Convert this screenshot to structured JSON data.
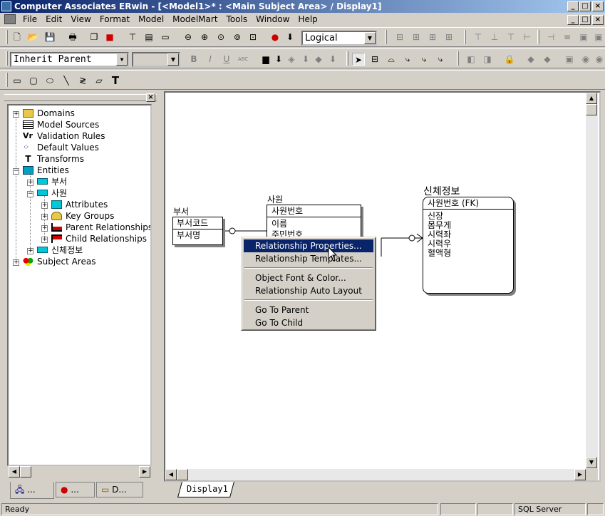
{
  "window": {
    "title": "Computer Associates ERwin - [<Model1>* : <Main Subject Area> / Display1]",
    "controls": [
      "_",
      "□",
      "×"
    ]
  },
  "menu": [
    "File",
    "Edit",
    "View",
    "Format",
    "Model",
    "ModelMart",
    "Tools",
    "Window",
    "Help"
  ],
  "toolbar": {
    "view_mode": "Logical",
    "font_combo": "Inherit Parent",
    "size_combo": "",
    "text_buttons": [
      "B",
      "I",
      "U",
      "ABC"
    ],
    "text_tool": "T"
  },
  "tree": {
    "items": [
      {
        "label": "Domains",
        "expand": "+"
      },
      {
        "label": "Model Sources",
        "expand": ""
      },
      {
        "label": "Validation Rules",
        "expand": ""
      },
      {
        "label": "Default Values",
        "expand": ""
      },
      {
        "label": "Transforms",
        "expand": ""
      },
      {
        "label": "Entities",
        "expand": "−"
      },
      {
        "label": "부서",
        "expand": "+"
      },
      {
        "label": "사원",
        "expand": "−"
      },
      {
        "label": "Attributes",
        "expand": "+"
      },
      {
        "label": "Key Groups",
        "expand": "+"
      },
      {
        "label": "Parent Relationships",
        "expand": "+"
      },
      {
        "label": "Child Relationships",
        "expand": "+"
      },
      {
        "label": "신체정보",
        "expand": "+"
      },
      {
        "label": "Subject Areas",
        "expand": "+"
      }
    ],
    "tabs": [
      "...",
      "...",
      "D..."
    ]
  },
  "diagram": {
    "entities": [
      {
        "name": "부서",
        "key": [
          "부서코드"
        ],
        "attrs": [
          "부서명"
        ]
      },
      {
        "name": "사원",
        "key": [
          "사원번호"
        ],
        "attrs": [
          "이름",
          "주민번호"
        ]
      },
      {
        "name": "신체정보",
        "key": [
          "사원번호 (FK)"
        ],
        "attrs": [
          "신장",
          "몸무게",
          "시력좌",
          "시력우",
          "혈액형"
        ]
      }
    ],
    "tab": "Display1"
  },
  "context_menu": {
    "items": [
      "Relationship Properties...",
      "Relationship Templates...",
      "Object Font & Color...",
      "Relationship Auto Layout",
      "Go To Parent",
      "Go To Child"
    ]
  },
  "status": {
    "left": "Ready",
    "db": "SQL Server"
  },
  "colors": {
    "title_bar": "#0a246a",
    "selection": "#0a246a",
    "chrome": "#d4d0c8"
  }
}
